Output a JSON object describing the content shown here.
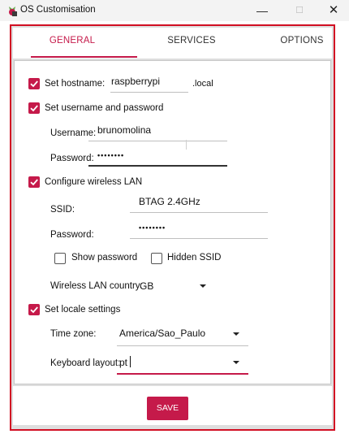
{
  "window": {
    "title": "OS Customisation",
    "minimize": "—",
    "maximize": "☐",
    "close": "✕"
  },
  "tabs": [
    {
      "label": "GENERAL"
    },
    {
      "label": "SERVICES"
    },
    {
      "label": "OPTIONS"
    }
  ],
  "hostname": {
    "label": "Set hostname:",
    "value": "raspberrypi",
    "suffix": ".local",
    "checked": true
  },
  "user": {
    "label": "Set username and password",
    "checked": true,
    "username_label": "Username:",
    "username_value": "brunomolina",
    "password_label": "Password:",
    "password_value": "••••••••"
  },
  "wifi": {
    "label": "Configure wireless LAN",
    "checked": true,
    "ssid_label": "SSID:",
    "ssid_value": "BTAG 2.4GHz",
    "password_label": "Password:",
    "password_value": "••••••••",
    "show_password_label": "Show password",
    "show_password_checked": false,
    "hidden_ssid_label": "Hidden SSID",
    "hidden_ssid_checked": false,
    "country_label": "Wireless LAN country:",
    "country_value": "GB"
  },
  "locale": {
    "label": "Set locale settings",
    "checked": true,
    "timezone_label": "Time zone:",
    "timezone_value": "America/Sao_Paulo",
    "keyboard_label": "Keyboard layout:",
    "keyboard_value": "pt"
  },
  "footer": {
    "save_label": "SAVE"
  },
  "colors": {
    "accent": "#c51a4a",
    "annotation_frame": "#d20f23"
  }
}
